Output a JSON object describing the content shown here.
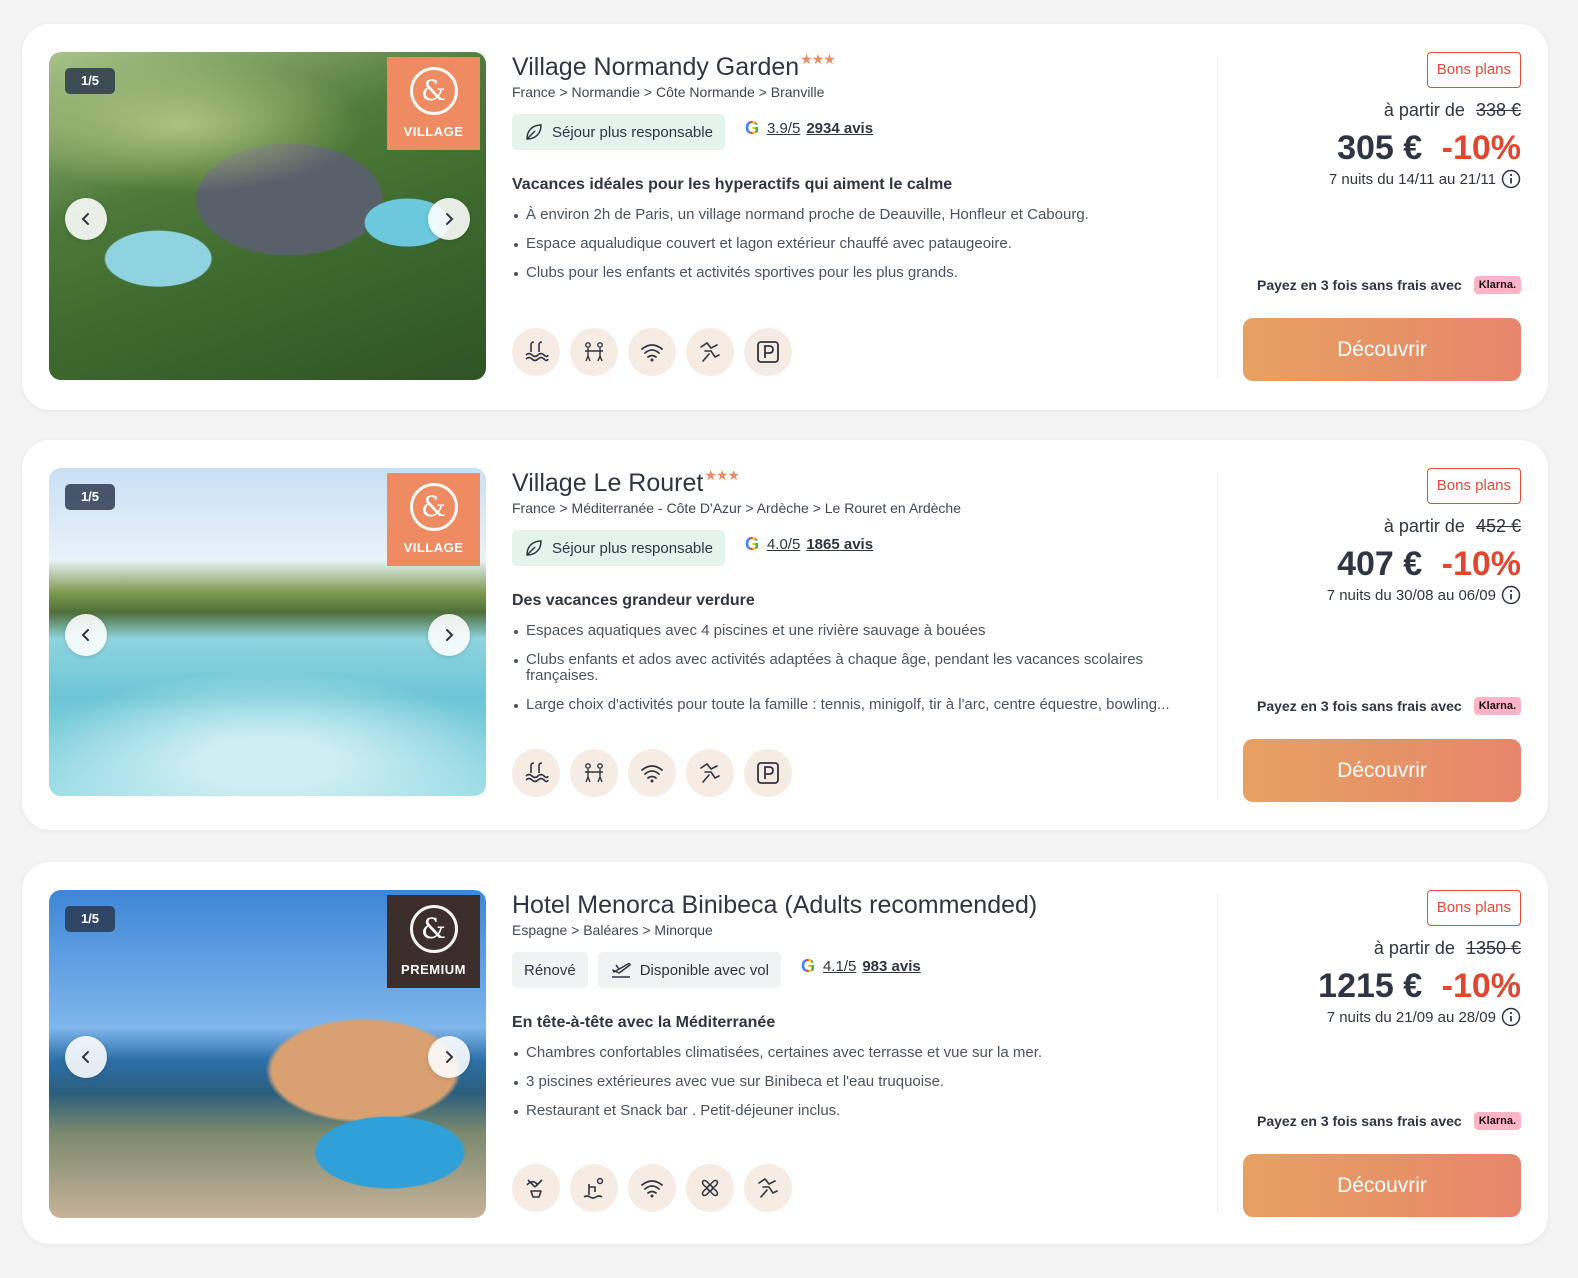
{
  "cards": [
    {
      "pager": "1/5",
      "brand": "VILLAGE",
      "title": "Village Normandy Garden",
      "stars": "★★★",
      "breadcrumb": "France > Normandie > Côte Normande > Branville",
      "tag1": "Séjour plus responsable",
      "rating_score": "3.9/5",
      "rating_count": "2934 avis",
      "headline": "Vacances idéales pour les hyperactifs qui aiment le calme",
      "bullets": [
        "À environ 2h de Paris, un village normand proche de Deauville, Honfleur et Cabourg.",
        "Espace aqualudique couvert et lagon extérieur chauffé avec pataugeoire.",
        "Clubs pour les enfants et activités sportives pour les plus grands."
      ],
      "amenities": [
        "pool-icon",
        "kids-club-icon",
        "wifi-icon",
        "activities-icon",
        "parking-icon"
      ],
      "deal": "Bons plans",
      "from_label": "à partir de",
      "old_price": "338 €",
      "price": "305 €",
      "discount": "-10%",
      "dates": "7 nuits du 14/11 au 21/11",
      "payment": "Payez en 3 fois sans frais avec",
      "klarna": "Klarna.",
      "cta": "Découvrir"
    },
    {
      "pager": "1/5",
      "brand": "VILLAGE",
      "title": "Village Le Rouret",
      "stars": "★★★",
      "breadcrumb": "France > Méditerranée - Côte D'Azur > Ardèche > Le Rouret en Ardèche",
      "tag1": "Séjour plus responsable",
      "rating_score": "4.0/5",
      "rating_count": "1865 avis",
      "headline": "Des vacances grandeur verdure",
      "bullets": [
        "Espaces aquatiques avec 4 piscines et une rivière sauvage à bouées",
        "Clubs enfants et ados avec activités adaptées à chaque âge, pendant les vacances scolaires françaises.",
        "Large choix d'activités pour toute la famille : tennis, minigolf, tir à l'arc, centre équestre, bowling..."
      ],
      "amenities": [
        "pool-icon",
        "kids-club-icon",
        "wifi-icon",
        "activities-icon",
        "parking-icon"
      ],
      "deal": "Bons plans",
      "from_label": "à partir de",
      "old_price": "452 €",
      "price": "407 €",
      "discount": "-10%",
      "dates": "7 nuits du 30/08 au 06/09",
      "payment": "Payez en 3 fois sans frais avec",
      "klarna": "Klarna.",
      "cta": "Découvrir"
    },
    {
      "pager": "1/5",
      "brand": "PREMIUM",
      "title": "Hotel Menorca Binibeca (Adults recommended)",
      "stars": "",
      "breadcrumb": "Espagne > Baléares > Minorque",
      "tag_renove": "Rénové",
      "tag_flight": "Disponible avec vol",
      "rating_score": "4.1/5",
      "rating_count": "983 avis",
      "headline": "En tête-à-tête avec la Méditerranée",
      "bullets": [
        "Chambres confortables climatisées, certaines avec terrasse et vue sur la mer.",
        "3 piscines extérieures avec vue sur Binibeca et l'eau truquoise.",
        "Restaurant et Snack bar . Petit-déjeuner inclus."
      ],
      "amenities": [
        "restaurant-icon",
        "beach-icon",
        "wifi-icon",
        "air-conditioning-icon",
        "activities-icon"
      ],
      "deal": "Bons plans",
      "from_label": "à partir de",
      "old_price": "1350 €",
      "price": "1215 €",
      "discount": "-10%",
      "dates": "7 nuits du 21/09 au 28/09",
      "payment": "Payez en 3 fois sans frais avec",
      "klarna": "Klarna.",
      "cta": "Découvrir"
    }
  ],
  "colors": {
    "accent": "#ee8b62",
    "discount": "#e0472f",
    "badge": "#e24a3c",
    "cta_start": "#e6a162",
    "cta_end": "#e7866b",
    "responsible_bg": "#e3f4ec",
    "klarna_bg": "#ffb3c7"
  }
}
